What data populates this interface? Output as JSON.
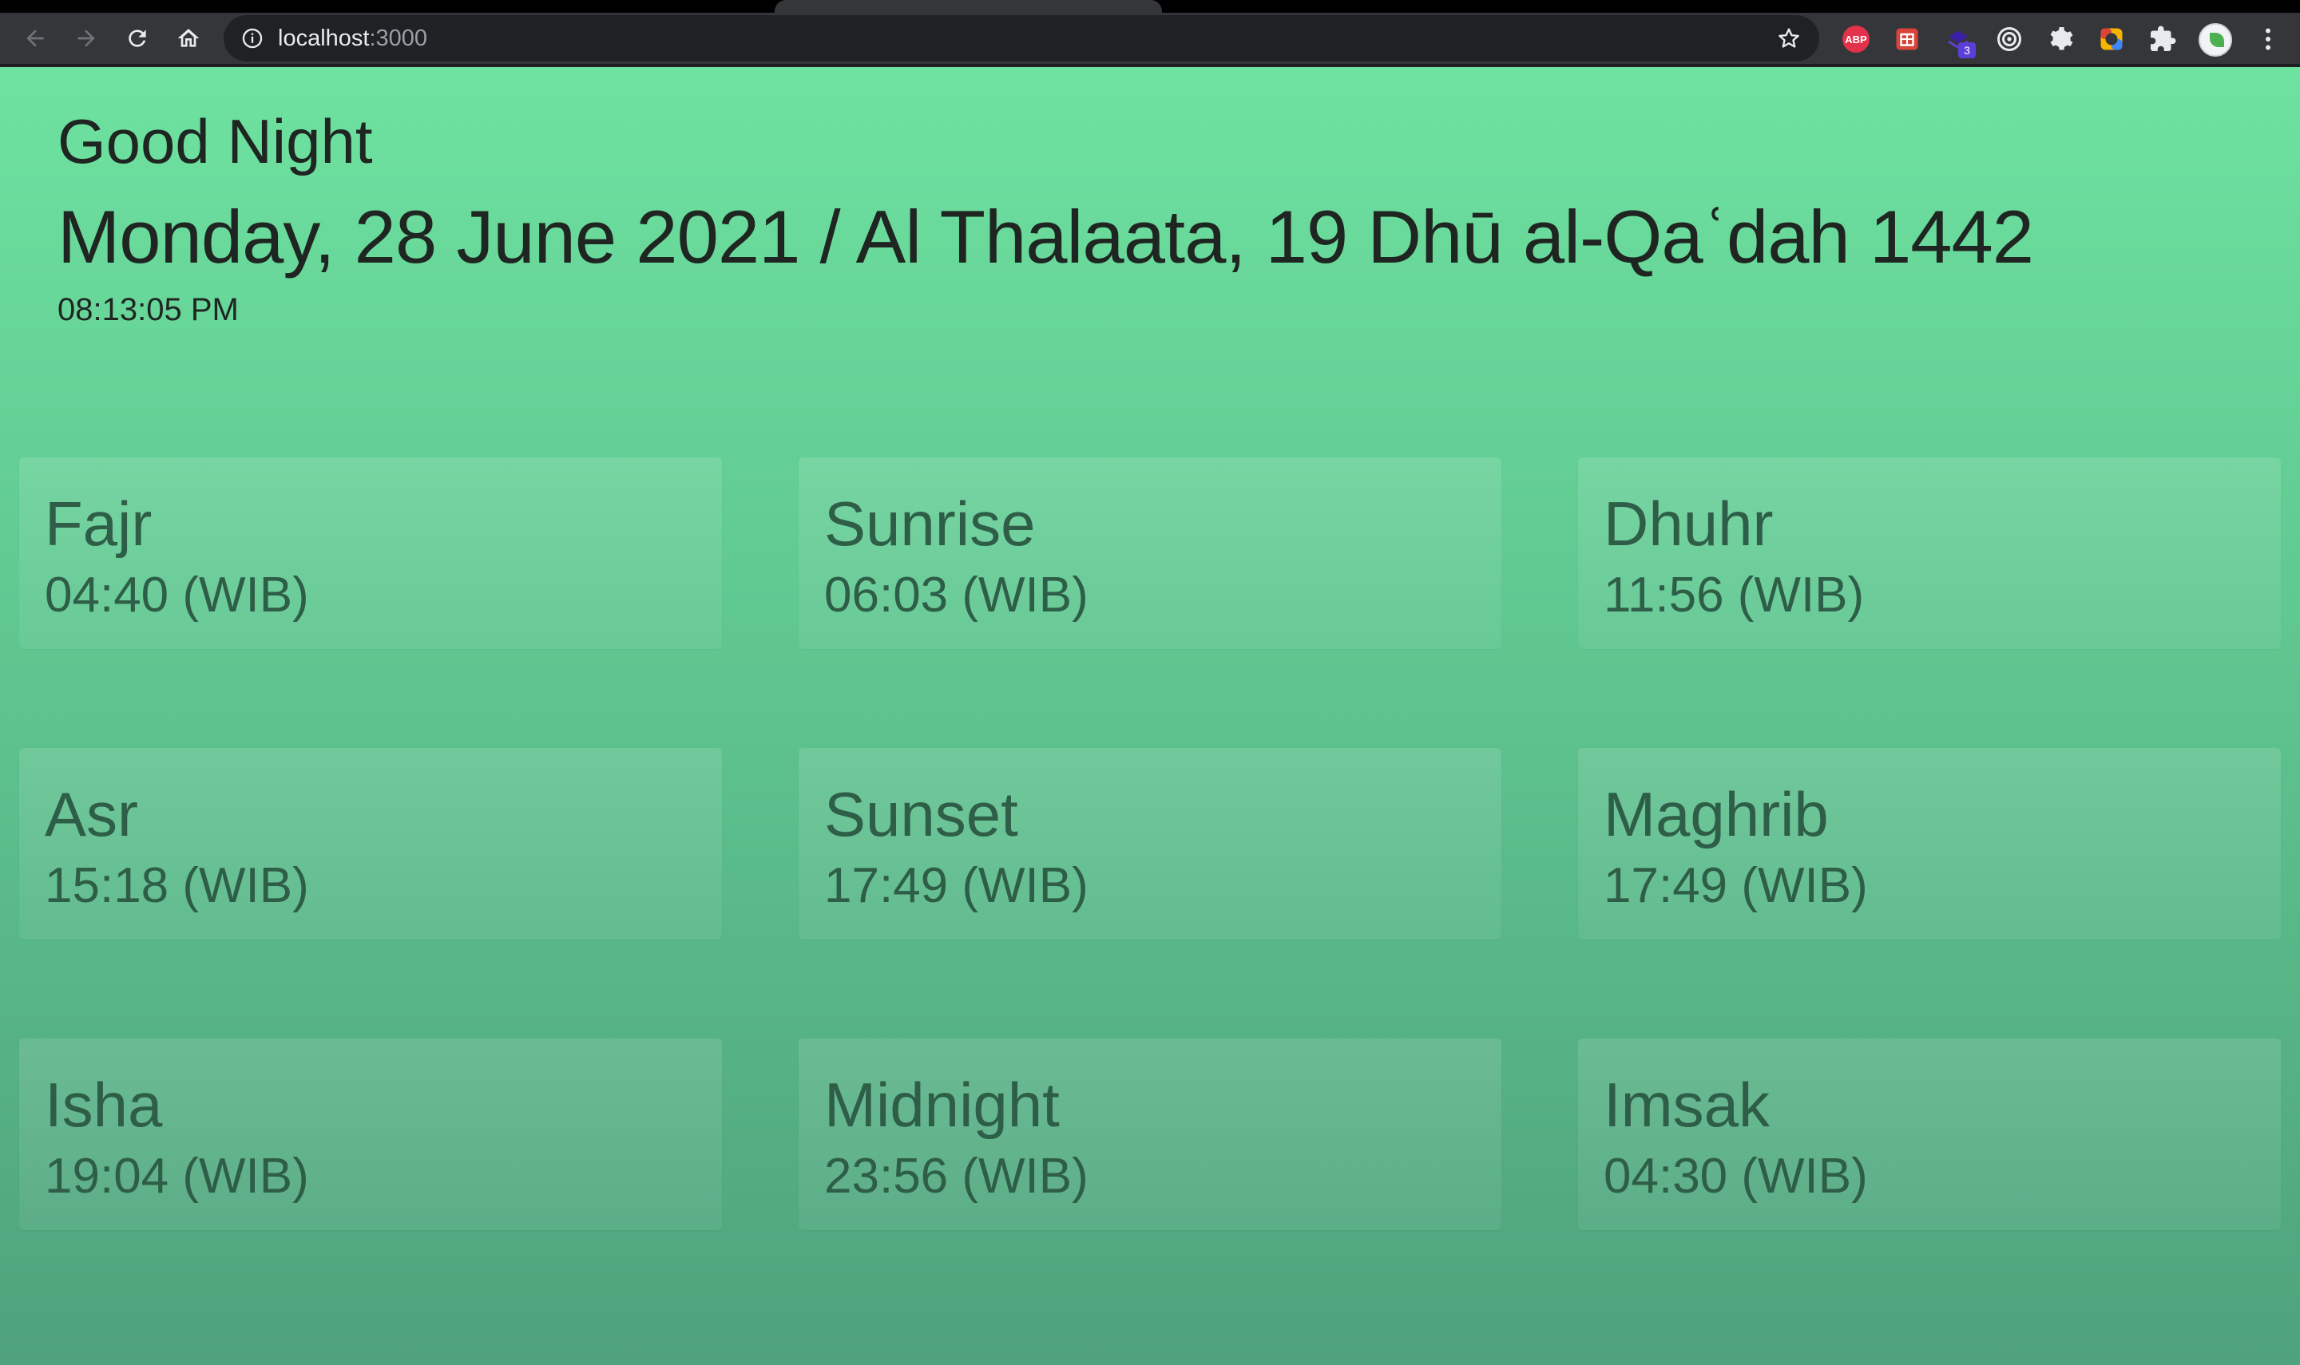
{
  "browser": {
    "url_host": "localhost",
    "url_port": ":3000",
    "extension_badge": "3",
    "abp_label": "ABP"
  },
  "page": {
    "greeting": "Good Night",
    "date_line": "Monday, 28 June 2021 / Al Thalaata, 19 Dhū al-Qaʿdah 1442",
    "clock": "08:13:05 PM"
  },
  "prayers": [
    {
      "name": "Fajr",
      "time": "04:40 (WIB)"
    },
    {
      "name": "Sunrise",
      "time": "06:03 (WIB)"
    },
    {
      "name": "Dhuhr",
      "time": "11:56 (WIB)"
    },
    {
      "name": "Asr",
      "time": "15:18 (WIB)"
    },
    {
      "name": "Sunset",
      "time": "17:49 (WIB)"
    },
    {
      "name": "Maghrib",
      "time": "17:49 (WIB)"
    },
    {
      "name": "Isha",
      "time": "19:04 (WIB)"
    },
    {
      "name": "Midnight",
      "time": "23:56 (WIB)"
    },
    {
      "name": "Imsak",
      "time": "04:30 (WIB)"
    }
  ],
  "colors": {
    "gradient_top": "#6ee2a0",
    "gradient_bottom": "#4fa27c",
    "card_text": "#2e5e47",
    "header_text": "#1f2622"
  },
  "icons": {
    "back": "arrow-left-icon",
    "forward": "arrow-right-icon",
    "reload": "reload-icon",
    "home": "home-icon",
    "site_info": "info-icon",
    "bookmark": "star-icon",
    "extensions": "puzzle-icon",
    "menu": "kebab-menu-icon"
  }
}
